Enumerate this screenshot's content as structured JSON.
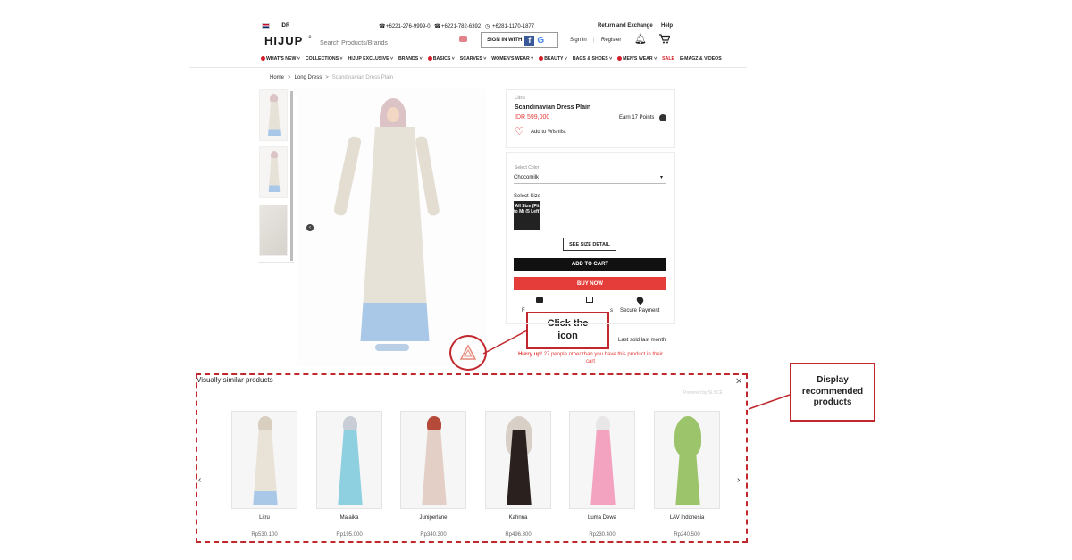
{
  "header": {
    "flag_label": "",
    "currency": "IDR",
    "phone1": "+6221-276-9999-0",
    "phone2": "+6221-782-6392",
    "whatsapp": "+6281-1170-1877",
    "return_link": "Return and Exchange",
    "help_link": "Help",
    "logo": "HIJUP",
    "search_placeholder": "Search Products/Brands",
    "sign_in_with": "SIGN IN WITH",
    "sign_in": "Sign In",
    "divider": "|",
    "register": "Register"
  },
  "nav": [
    {
      "label": "WHAT'S NEW",
      "dot": true
    },
    {
      "label": "COLLECTIONS",
      "dot": false
    },
    {
      "label": "HIJUP EXCLUSIVE",
      "dot": false
    },
    {
      "label": "BRANDS",
      "dot": false
    },
    {
      "label": "BASICS",
      "dot": true
    },
    {
      "label": "SCARVES",
      "dot": false
    },
    {
      "label": "WOMEN'S WEAR",
      "dot": false
    },
    {
      "label": "BEAUTY",
      "dot": true
    },
    {
      "label": "BAGS & SHOES",
      "dot": false
    },
    {
      "label": "MEN'S WEAR",
      "dot": true
    },
    {
      "label": "SALE",
      "dot": false,
      "sale": true
    },
    {
      "label": "E-MAGZ & VIDEOS",
      "dot": false
    }
  ],
  "breadcrumb": {
    "home": "Home",
    "sep": ">",
    "category": "Long Dress",
    "current": "Scandinavian Dress Plain"
  },
  "product": {
    "brand": "Litru",
    "name": "Scandinavian Dress Plain",
    "price": "IDR 599,000",
    "points": "Earn 17 Points",
    "wishlist": "Add to Wishlist",
    "select_color_label": "Select Color",
    "color_value": "Chocomilk",
    "select_size_label": "Select Size",
    "size_option": "All Size (Fit to M) (5 Left)",
    "size_detail": "SEE SIZE DETAIL",
    "add_to_cart": "ADD TO CART",
    "buy_now": "BUY NOW",
    "feature_left": "F",
    "feature_mid": "s",
    "secure_payment": "Secure Payment",
    "last_sold": "Last sold last month",
    "hurry_prefix": "Hurry up!",
    "hurry_text": "27 people other than you have this product in their cart"
  },
  "callouts": {
    "click_icon": "Click the icon",
    "display_reco": "Display recommended products"
  },
  "similar": {
    "title": "Visually similar products",
    "powered_by": "Powered by SLYCE",
    "items": [
      {
        "name": "Litru",
        "price": "Rp530.100",
        "color": "#e9e2d6",
        "accent": "#a9c8e8",
        "hijab": "#d9cfc1"
      },
      {
        "name": "Malaika",
        "price": "Rp195.000",
        "color": "#8ecfe0",
        "accent": "#8ecfe0",
        "hijab": "#c8cdd6"
      },
      {
        "name": "Juniperlane",
        "price": "Rp340.300",
        "color": "#e3cfc6",
        "accent": "#e3cfc6",
        "hijab": "#b54a3a"
      },
      {
        "name": "Kahnna",
        "price": "Rp496.300",
        "color": "#2a211e",
        "accent": "#2a211e",
        "hijab": "#d8d0c6"
      },
      {
        "name": "Luma Dewa",
        "price": "Rp230.400",
        "color": "#f3a3c0",
        "accent": "#f3a3c0",
        "hijab": "#e8e6e6"
      },
      {
        "name": "LAV Indonesia",
        "price": "Rp240.500",
        "color": "#9cc46a",
        "accent": "#9cc46a",
        "hijab": "#9cc46a"
      }
    ]
  },
  "colors": {
    "accent_red": "#e53e3a",
    "callout_red": "#c0282d",
    "dress_main": "#e7e2d8",
    "dress_hem": "#a9c8e8",
    "hijab_pink": "#dcc3c5"
  }
}
